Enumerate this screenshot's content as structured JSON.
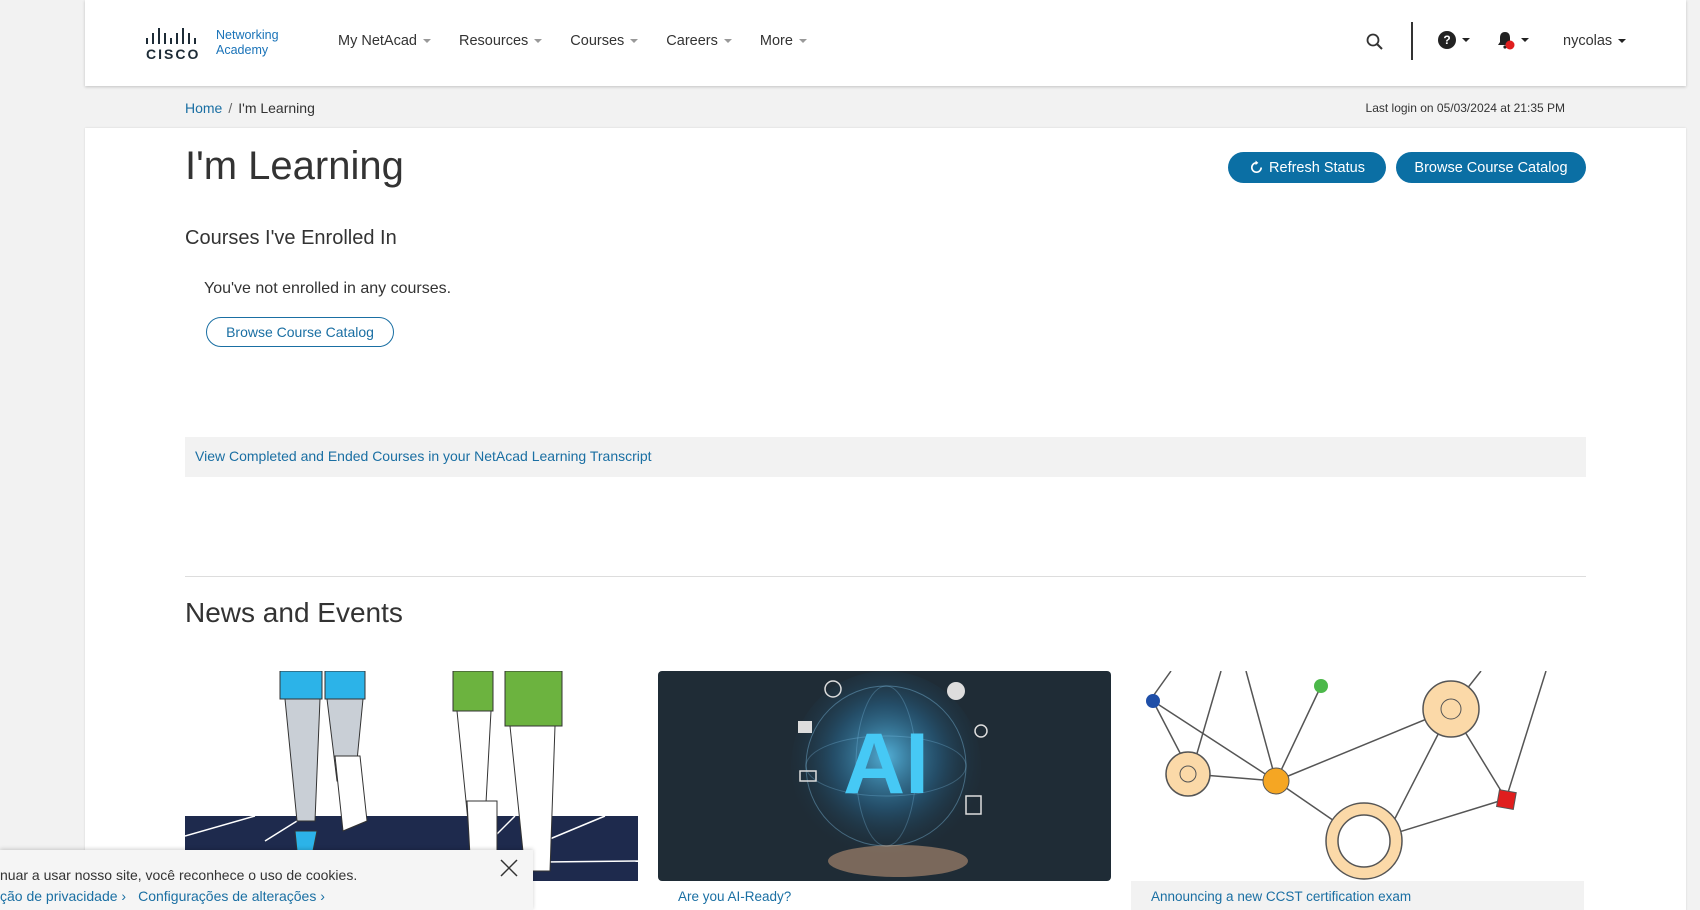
{
  "header": {
    "brand_mark": "CISCO",
    "brand_text_line1": "Networking",
    "brand_text_line2": "Academy",
    "nav": [
      {
        "label": "My NetAcad"
      },
      {
        "label": "Resources"
      },
      {
        "label": "Courses"
      },
      {
        "label": "Careers"
      },
      {
        "label": "More"
      }
    ],
    "help_icon": "?",
    "username": "nycolas"
  },
  "breadcrumb": {
    "home": "Home",
    "separator": "/",
    "current": "I'm Learning"
  },
  "last_login": "Last login on 05/03/2024 at 21:35 PM",
  "main": {
    "title": "I'm Learning",
    "refresh_button": "Refresh Status",
    "browse_button": "Browse Course Catalog",
    "enrolled_heading": "Courses I've Enrolled In",
    "empty_message": "You've not enrolled in any courses.",
    "browse_outline_button": "Browse Course Catalog",
    "transcript_link": "View Completed and Ended Courses in your NetAcad Learning Transcript",
    "news_heading": "News and Events",
    "news_cards": [
      {
        "caption": ""
      },
      {
        "caption": "Are you AI-Ready?",
        "image_text": "AI"
      },
      {
        "caption": "Announcing a new CCST certification exam"
      }
    ]
  },
  "cookie_banner": {
    "text": "nuar a usar nosso site, você reconhece o uso de cookies.",
    "privacy_link": "ção de privacidade",
    "settings_link": "Configurações de alterações"
  },
  "colors": {
    "primary": "#0b6fa4",
    "link": "#1a6fa3",
    "notification_dot": "#e01e1e"
  }
}
